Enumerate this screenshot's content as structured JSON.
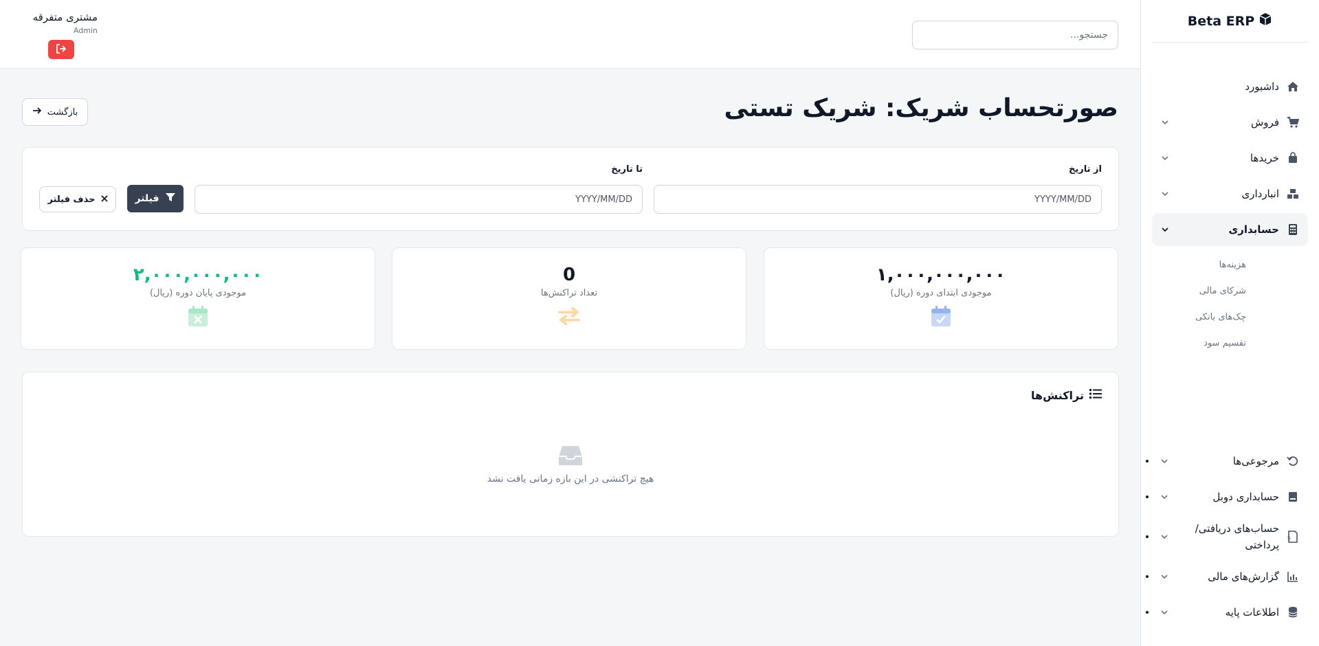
{
  "brand": {
    "name": "Beta ERP",
    "icon": "cube-icon"
  },
  "header": {
    "search_placeholder": "جستجو...",
    "user_name": "مشتری متفرقه",
    "user_role": "Admin",
    "logout_icon": "logout-icon"
  },
  "sidebar": {
    "items": [
      {
        "label": "داشبورد",
        "icon": "home-icon"
      },
      {
        "label": "فروش",
        "icon": "cart-icon"
      },
      {
        "label": "خریدها",
        "icon": "bag-icon"
      },
      {
        "label": "انبارداری",
        "icon": "boxes-icon"
      },
      {
        "label": "حسابداری",
        "icon": "calculator-icon"
      }
    ],
    "accounting_sub": [
      "هزینه‌ها",
      "شرکای مالی",
      "چک‌های بانکی",
      "تقسیم سود"
    ],
    "bottom_items": [
      {
        "label": "مرجوعی‌ها",
        "icon": "undo-icon"
      },
      {
        "label": "حسابداری دوبل",
        "icon": "book-icon"
      },
      {
        "label": "حساب‌های دریافتی/ پرداختی",
        "icon": "invoice-icon"
      },
      {
        "label": "گزارش‌های مالی",
        "icon": "chart-icon"
      },
      {
        "label": "اطلاعات پایه",
        "icon": "database-icon"
      }
    ]
  },
  "page": {
    "title": "صورتحساب شریک: شریک تستی",
    "back_label": "بازگشت"
  },
  "filter": {
    "from_label": "از تاریخ",
    "to_label": "تا تاریخ",
    "from_placeholder": "YYYY/MM/DD",
    "to_placeholder": "YYYY/MM/DD",
    "filter_label": "فیلتر",
    "clear_label": "حذف فیلتر"
  },
  "stats": [
    {
      "value": "۱,۰۰۰,۰۰۰,۰۰۰",
      "label": "موجودی ابتدای دوره (ریال)",
      "icon": "calendar-check-icon",
      "color": "#111827",
      "icon_color": "#93b4f0"
    },
    {
      "value": "0",
      "label": "تعداد تراکنش‌ها",
      "icon": "exchange-icon",
      "color": "#111827",
      "icon_color": "#fcd9a4"
    },
    {
      "value": "۲,۰۰۰,۰۰۰,۰۰۰",
      "label": "موجودی پایان دوره (ریال)",
      "icon": "calendar-x-icon",
      "color": "#10b981",
      "icon_color": "#a7e6c9"
    }
  ],
  "transactions": {
    "title": "تراکنش‌ها",
    "empty_text": "هیچ تراکنشی در این بازه زمانی یافت نشد"
  },
  "colors": {
    "danger": "#ef4444",
    "dark_button": "#374151",
    "success": "#10b981"
  }
}
